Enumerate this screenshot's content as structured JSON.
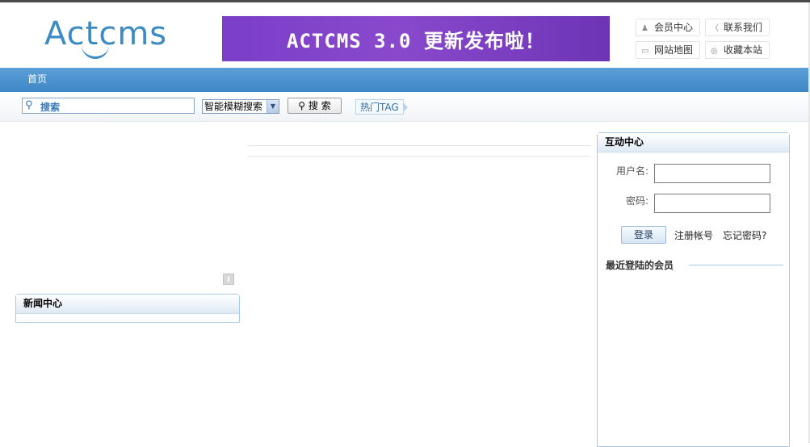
{
  "header": {
    "logo_text": "Actcms",
    "banner_text": "ACTCMS 3.0 更新发布啦！",
    "quick_links": [
      {
        "label": "会员中心",
        "icon": "user-icon"
      },
      {
        "label": "联系我们",
        "icon": "chat-bubble-icon"
      },
      {
        "label": "网站地图",
        "icon": "folder-icon"
      },
      {
        "label": "收藏本站",
        "icon": "star-circle-icon"
      }
    ]
  },
  "nav": {
    "items": [
      {
        "label": "首页"
      }
    ]
  },
  "search": {
    "placeholder": "搜索",
    "mode_selected": "智能模糊搜索",
    "button_label": "搜 索",
    "hot_tag_label": "热门TAG"
  },
  "left": {
    "news_title": "新闻中心"
  },
  "member": {
    "title": "互动中心",
    "username_label": "用户名:",
    "password_label": "密码:",
    "login_label": "登录",
    "register_label": "注册帐号",
    "forgot_label": "忘记密码?",
    "recent_title": "最近登陆的会员"
  },
  "colors": {
    "nav_blue": "#4a90cf",
    "logo_blue": "#3c8bc3",
    "banner_purple": "#7a3ec8",
    "box_border": "#a9c8e2"
  }
}
